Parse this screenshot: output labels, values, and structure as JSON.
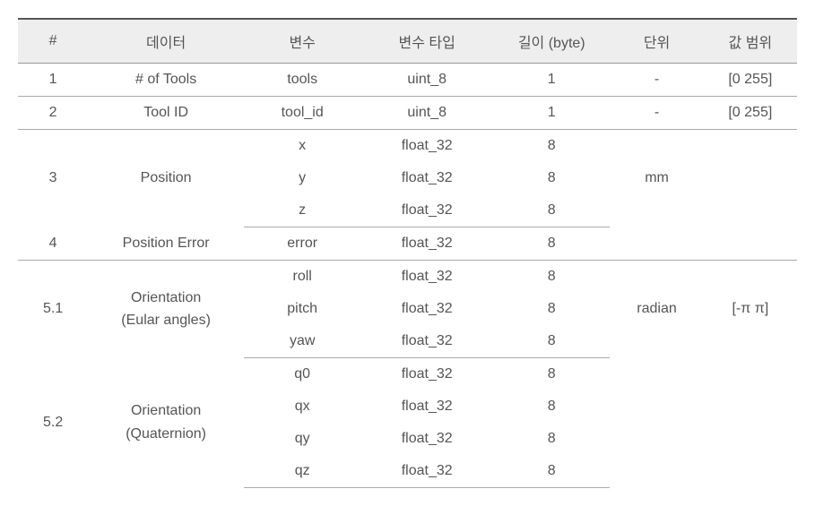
{
  "chart_data": {
    "type": "table",
    "headers": [
      "#",
      "데이터",
      "변수",
      "변수 타입",
      "길이 (byte)",
      "단위",
      "값 범위"
    ],
    "rows": [
      {
        "id": "1",
        "data": "# of Tools",
        "var": "tools",
        "type": "uint_8",
        "len": "1",
        "unit": "-",
        "range": "[0 255]"
      },
      {
        "id": "2",
        "data": "Tool ID",
        "var": "tool_id",
        "type": "uint_8",
        "len": "1",
        "unit": "-",
        "range": "[0 255]"
      },
      {
        "id": "3",
        "data": "Position",
        "var": "x",
        "type": "float_32",
        "len": "8",
        "unit": "mm",
        "range": ""
      },
      {
        "id": "",
        "data": "",
        "var": "y",
        "type": "float_32",
        "len": "8",
        "unit": "",
        "range": ""
      },
      {
        "id": "",
        "data": "",
        "var": "z",
        "type": "float_32",
        "len": "8",
        "unit": "",
        "range": ""
      },
      {
        "id": "4",
        "data": "Position Error",
        "var": "error",
        "type": "float_32",
        "len": "8",
        "unit": "",
        "range": ""
      },
      {
        "id": "5.1",
        "data": "Orientation (Eular angles)",
        "var": "roll",
        "type": "float_32",
        "len": "8",
        "unit": "radian",
        "range": "[-π π]"
      },
      {
        "id": "",
        "data": "",
        "var": "pitch",
        "type": "float_32",
        "len": "8",
        "unit": "",
        "range": ""
      },
      {
        "id": "",
        "data": "",
        "var": "yaw",
        "type": "float_32",
        "len": "8",
        "unit": "",
        "range": ""
      },
      {
        "id": "5.2",
        "data": "Orientation (Quaternion)",
        "var": "q0",
        "type": "float_32",
        "len": "8",
        "unit": "",
        "range": ""
      },
      {
        "id": "",
        "data": "",
        "var": "qx",
        "type": "float_32",
        "len": "8",
        "unit": "",
        "range": ""
      },
      {
        "id": "",
        "data": "",
        "var": "qy",
        "type": "float_32",
        "len": "8",
        "unit": "",
        "range": ""
      },
      {
        "id": "",
        "data": "",
        "var": "qz",
        "type": "float_32",
        "len": "8",
        "unit": "",
        "range": ""
      }
    ]
  },
  "headers": {
    "num": "#",
    "data": "데이터",
    "var": "변수",
    "type": "변수 타입",
    "len": "길이 (byte)",
    "unit": "단위",
    "range": "값 범위"
  },
  "rows": {
    "r1": {
      "id": "1",
      "data": "# of Tools",
      "var": "tools",
      "type": "uint_8",
      "len": "1",
      "unit": "-",
      "range": "[0 255]"
    },
    "r2": {
      "id": "2",
      "data": "Tool ID",
      "var": "tool_id",
      "type": "uint_8",
      "len": "1",
      "unit": "-",
      "range": "[0 255]"
    },
    "r3": {
      "id": "3",
      "data": "Position",
      "unit": "mm",
      "sub": [
        {
          "var": "x",
          "type": "float_32",
          "len": "8"
        },
        {
          "var": "y",
          "type": "float_32",
          "len": "8"
        },
        {
          "var": "z",
          "type": "float_32",
          "len": "8"
        }
      ]
    },
    "r4": {
      "id": "4",
      "data": "Position Error",
      "var": "error",
      "type": "float_32",
      "len": "8",
      "unit": "",
      "range": ""
    },
    "r51": {
      "id": "5.1",
      "data_l1": "Orientation",
      "data_l2": "(Eular angles)",
      "unit": "radian",
      "range": "[-π π]",
      "sub": [
        {
          "var": "roll",
          "type": "float_32",
          "len": "8"
        },
        {
          "var": "pitch",
          "type": "float_32",
          "len": "8"
        },
        {
          "var": "yaw",
          "type": "float_32",
          "len": "8"
        }
      ]
    },
    "r52": {
      "id": "5.2",
      "data_l1": "Orientation",
      "data_l2": "(Quaternion)",
      "unit": "",
      "range": "",
      "sub": [
        {
          "var": "q0",
          "type": "float_32",
          "len": "8"
        },
        {
          "var": "qx",
          "type": "float_32",
          "len": "8"
        },
        {
          "var": "qy",
          "type": "float_32",
          "len": "8"
        },
        {
          "var": "qz",
          "type": "float_32",
          "len": "8"
        }
      ]
    }
  }
}
